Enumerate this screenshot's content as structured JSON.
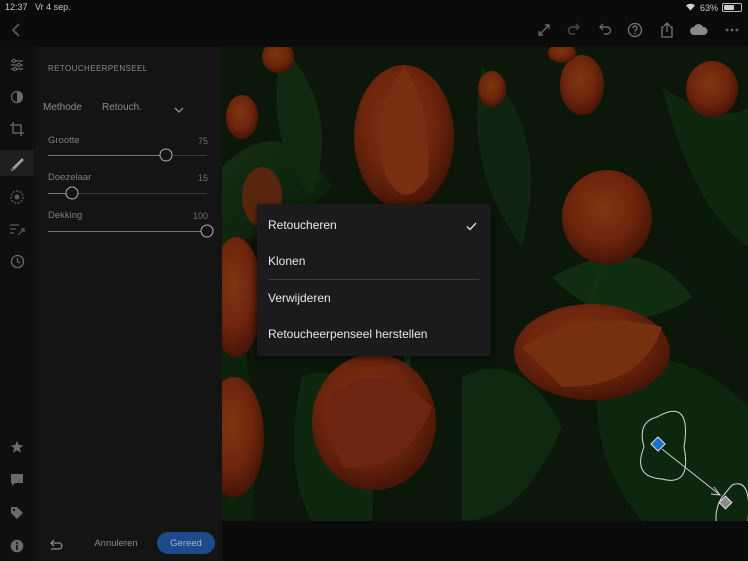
{
  "status_bar": {
    "time": "12:37",
    "date": "Vr 4 sep.",
    "battery_text": "63%",
    "battery_level": 0.63
  },
  "toolbar": {
    "back_icon": "chevron-left-icon",
    "icons": [
      "expand-icon",
      "redo-icon",
      "undo-icon",
      "help-icon",
      "share-icon",
      "cloud-sync-icon",
      "more-icon"
    ]
  },
  "rail": {
    "icons": [
      "sliders-icon",
      "presets-icon",
      "crop-icon",
      "healing-brush-icon",
      "selective-icon",
      "geometry-icon",
      "history-icon",
      "star-icon",
      "comment-icon",
      "tag-icon",
      "info-icon"
    ],
    "active": "healing-brush-icon"
  },
  "panel": {
    "title": "RETOUCHEERPENSEEL",
    "method_label": "Methode",
    "method_value": "Retouch.",
    "sliders": [
      {
        "label": "Grootte",
        "value_text": "75",
        "level": 0.74
      },
      {
        "label": "Doezelaar",
        "value_text": "15",
        "level": 0.15
      },
      {
        "label": "Dekking",
        "value_text": "100",
        "level": 1.0
      }
    ],
    "cancel_label": "Annuleren",
    "done_label": "Gereed"
  },
  "menu": {
    "items": [
      {
        "label": "Retoucheren",
        "checked": true
      },
      {
        "label": "Klonen",
        "checked": false
      },
      {
        "label": "Verwijderen",
        "checked": false
      },
      {
        "label": "Retoucheerpenseel herstellen",
        "checked": false
      }
    ]
  },
  "colors": {
    "accent": "#1d4a8a",
    "spot_marker": "#1f6fd0"
  }
}
